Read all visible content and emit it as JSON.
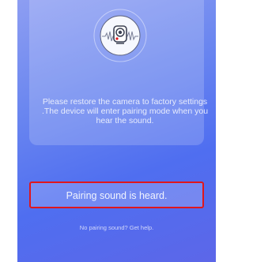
{
  "pairing_step": {
    "instruction_text": "Please restore the camera to factory settings .The device will enter pairing mode when you hear the sound.",
    "confirm_button_label": "Pairing sound is heard.",
    "help_link_label": "No pairing sound? Get help."
  },
  "icons": {
    "illustration": "camera-sound-wave-icon"
  },
  "colors": {
    "background_top": "#8f9ff2",
    "background_bottom": "#5d66e8",
    "highlight_border": "#e0161c",
    "camera_indicator": "#e0161c"
  }
}
